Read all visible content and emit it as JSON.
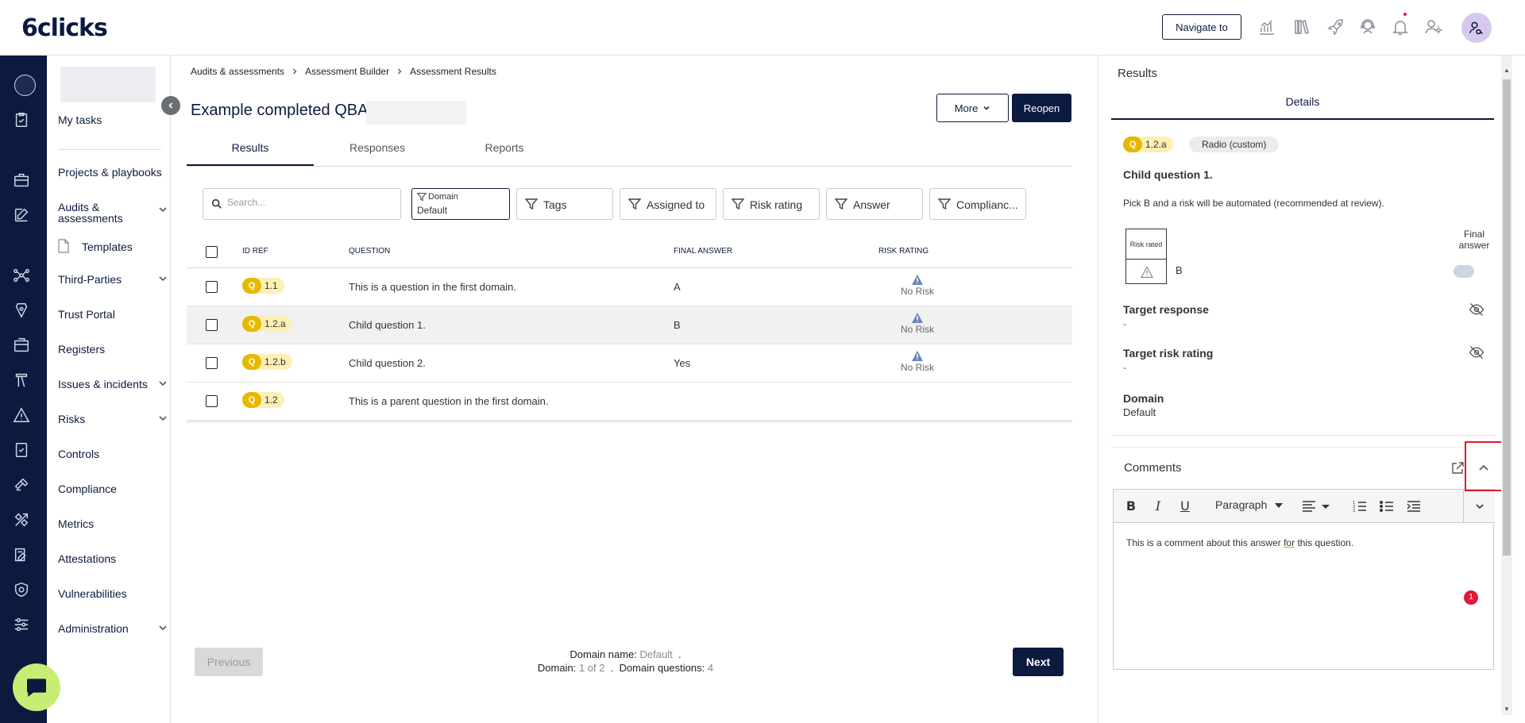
{
  "app": {
    "logo_text": "6clicks"
  },
  "header": {
    "navigate_label": "Navigate to",
    "icons": [
      "analytics-icon",
      "library-icon",
      "rocket-icon",
      "support-icon",
      "bell-icon",
      "user-settings-icon",
      "user-search-icon"
    ]
  },
  "nav": {
    "my_tasks": "My tasks",
    "projects": "Projects & playbooks",
    "audits": "Audits & assessments",
    "templates": "Templates",
    "third_parties": "Third-Parties",
    "trust_portal": "Trust Portal",
    "registers": "Registers",
    "issues": "Issues & incidents",
    "risks": "Risks",
    "controls": "Controls",
    "compliance": "Compliance",
    "metrics": "Metrics",
    "attestations": "Attestations",
    "vulnerabilities": "Vulnerabilities",
    "administration": "Administration"
  },
  "breadcrumb": {
    "items": [
      "Audits & assessments",
      "Assessment Builder",
      "Assessment Results"
    ]
  },
  "page": {
    "title": "Example completed QBA",
    "more_label": "More",
    "reopen_label": "Reopen"
  },
  "tabs": [
    "Results",
    "Responses",
    "Reports"
  ],
  "filters": {
    "search_placeholder": "Search...",
    "domain_label": "Domain",
    "domain_value": "Default",
    "tags": "Tags",
    "assigned_to": "Assigned to",
    "risk_rating": "Risk rating",
    "answer": "Answer",
    "compliance": "Complianc..."
  },
  "table": {
    "headers": {
      "id_ref": "ID REF",
      "question": "QUESTION",
      "final_answer": "FINAL ANSWER",
      "risk_rating": "RISK RATING"
    },
    "rows": [
      {
        "q": "Q",
        "id": "1.1",
        "question": "This is a question in the first domain.",
        "answer": "A",
        "risk": "No Risk"
      },
      {
        "q": "Q",
        "id": "1.2.a",
        "question": "Child question 1.",
        "answer": "B",
        "risk": "No Risk"
      },
      {
        "q": "Q",
        "id": "1.2.b",
        "question": "Child question 2.",
        "answer": "Yes",
        "risk": "No Risk"
      },
      {
        "q": "Q",
        "id": "1.2",
        "question": "This is a parent question in the first domain.",
        "answer": "",
        "risk": ""
      }
    ]
  },
  "pager": {
    "previous": "Previous",
    "next": "Next",
    "domain_name_label": "Domain name:",
    "domain_name_value": "Default",
    "dot": ".",
    "domain_label": "Domain:",
    "domain_value": "1 of 2",
    "domain_questions_label": "Domain questions:",
    "domain_questions_value": "4"
  },
  "results_panel": {
    "title": "Results",
    "tab": "Details",
    "q_badge": "Q",
    "q_id": "1.2.a",
    "type": "Radio (custom)",
    "question_title": "Child question 1.",
    "description": "Pick B and a risk will be automated (recommended at review).",
    "risk_rated": "Risk rated",
    "answer": "B",
    "final_answer": "Final answer",
    "target_response_label": "Target response",
    "target_response_value": "-",
    "target_risk_label": "Target risk rating",
    "target_risk_value": "-",
    "domain_label": "Domain",
    "domain_value": "Default",
    "comments_label": "Comments",
    "paragraph": "Paragraph",
    "comment_pre": "This is a comment about this answer ",
    "comment_u": "for",
    "comment_post": " this question.",
    "notif_count": "1"
  },
  "colors": {
    "brand_navy": "#0c1a40",
    "q_badge": "#e6b800",
    "chat_button": "#c6ee74",
    "highlight": "#e0192e"
  }
}
